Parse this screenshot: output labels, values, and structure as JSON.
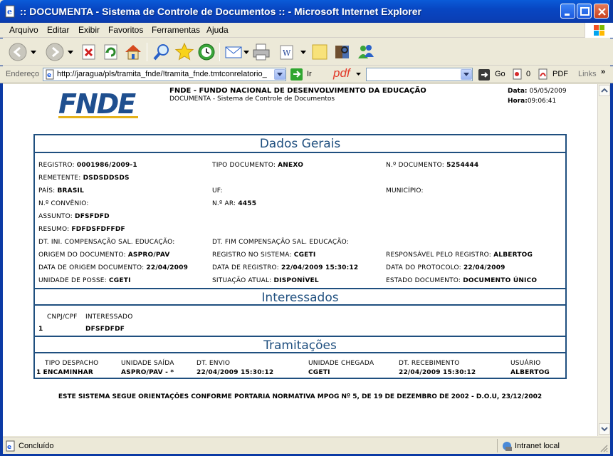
{
  "window": {
    "title": ":: DOCUMENTA - Sistema de Controle de Documentos :: - Microsoft Internet Explorer"
  },
  "menu": [
    "Arquivo",
    "Editar",
    "Exibir",
    "Favoritos",
    "Ferramentas",
    "Ajuda"
  ],
  "toolbar": {
    "buttons": [
      "back-icon",
      "forward-icon",
      "stop-icon",
      "refresh-icon",
      "home-icon",
      "search-icon",
      "favorites-icon",
      "history-icon",
      "mail-icon",
      "print-icon",
      "word-icon",
      "notes-icon",
      "research-icon",
      "messenger-icon"
    ]
  },
  "address": {
    "label": "Endereço",
    "url": "http://jaragua/pls/tramita_fnde/!tramita_fnde.tmtconrelatorio_",
    "go_label": "Ir",
    "pdf_label": "pdf",
    "go2_label": "Go",
    "count": "0",
    "pdf2_label": "PDF",
    "links_label": "Links"
  },
  "header": {
    "logo": "FNDE",
    "org": "FNDE - FUNDO NACIONAL DE DESENVOLVIMENTO DA EDUCAÇÃO",
    "system": "DOCUMENTA - Sistema de Controle de Documentos",
    "date_label": "Data:",
    "date_value": "05/05/2009",
    "time_label": "Hora:",
    "time_value": "09:06:41"
  },
  "dados_gerais": {
    "title": "Dados Gerais",
    "registro_label": "REGISTRO:",
    "registro": "0001986/2009-1",
    "tipo_label": "TIPO DOCUMENTO:",
    "tipo": "ANEXO",
    "ndoc_label": "N.º DOCUMENTO:",
    "ndoc": "5254444",
    "remetente_label": "REMETENTE:",
    "remetente": "DSDSDDSDS",
    "pais_label": "PAÍS:",
    "pais": "BRASIL",
    "uf_label": "UF:",
    "municipio_label": "MUNICÍPIO:",
    "convenio_label": "N.º CONVÊNIO:",
    "ar_label": "N.º AR:",
    "ar": "4455",
    "assunto_label": "ASSUNTO:",
    "assunto": "DFSFDFD",
    "resumo_label": "RESUMO:",
    "resumo": "FDFDSFDFFDF",
    "dt_ini_label": "DT. INI. COMPENSAÇÃO SAL. EDUCAÇÃO:",
    "dt_fim_label": "DT. FIM COMPENSAÇÃO SAL. EDUCAÇÃO:",
    "origem_label": "ORIGEM DO DOCUMENTO:",
    "origem": "ASPRO/PAV",
    "reg_sistema_label": "REGISTRO NO SISTEMA:",
    "reg_sistema": "CGETI",
    "responsavel_label": "RESPONSÁVEL PELO REGISTRO:",
    "responsavel": "ALBERTOG",
    "data_origem_label": "DATA DE ORIGEM DOCUMENTO:",
    "data_origem": "22/04/2009",
    "data_registro_label": "DATA DE REGISTRO:",
    "data_registro": "22/04/2009 15:30:12",
    "data_protocolo_label": "DATA DO PROTOCOLO:",
    "data_protocolo": "22/04/2009",
    "unidade_posse_label": "UNIDADE DE POSSE:",
    "unidade_posse": "CGETI",
    "situacao_label": "SITUAÇÃO ATUAL:",
    "situacao": "DISPONÍVEL",
    "estado_label": "ESTADO DOCUMENTO:",
    "estado": "DOCUMENTO ÚNICO"
  },
  "interessados": {
    "title": "Interessados",
    "col_cnpj": "CNPJ/CPF",
    "col_interessado": "INTERESSADO",
    "rows": [
      {
        "num": "1",
        "interessado": "DFSFDFDF"
      }
    ]
  },
  "tramitacoes": {
    "title": "Tramitações",
    "columns": [
      "TIPO DESPACHO",
      "UNIDADE SAÍDA",
      "DT. ENVIO",
      "UNIDADE CHEGADA",
      "DT. RECEBIMENTO",
      "USUÁRIO"
    ],
    "rows": [
      {
        "num": "1",
        "tipo": "ENCAMINHAR",
        "saida": "ASPRO/PAV - *",
        "envio": "22/04/2009 15:30:12",
        "chegada": "CGETI",
        "recebimento": "22/04/2009 15:30:12",
        "usuario": "ALBERTOG"
      }
    ]
  },
  "footer": "ESTE SISTEMA SEGUE ORIENTAÇÕES CONFORME PORTARIA NORMATIVA MPOG Nº 5, DE 19 DE DEZEMBRO DE 2002 - D.O.U, 23/12/2002",
  "status": {
    "text": "Concluído",
    "zone": "Intranet local"
  },
  "colors": {
    "titlebar": "#0a4fcf",
    "section_border": "#1f4f7f",
    "logo_blue": "#1f4f8f"
  }
}
